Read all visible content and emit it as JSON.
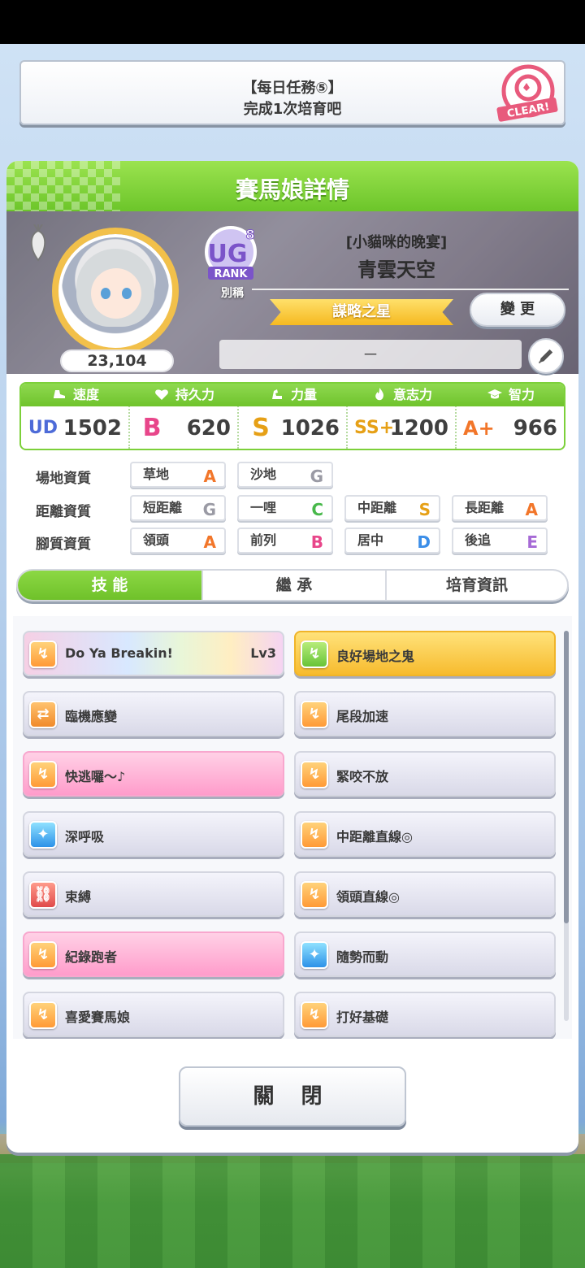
{
  "mission": {
    "title": "【每日任務⑤】",
    "desc": "完成1次培育吧",
    "stamp": "CLEAR!"
  },
  "dialog": {
    "title": "賽馬娘詳情"
  },
  "profile": {
    "points": "23,104",
    "rank_badge": {
      "letters": "UG",
      "sub": "8",
      "label": "RANK"
    },
    "alias_label": "別稱",
    "epithet": "[小貓咪的晚宴]",
    "name": "青雲天空",
    "nickname": "謀略之星",
    "change_label": "變 更",
    "memo": "－"
  },
  "stats": [
    {
      "label": "速度",
      "grade": "UD",
      "value": "1502",
      "icon": "shoe-icon"
    },
    {
      "label": "持久力",
      "grade": "B",
      "value": "620",
      "icon": "heart-icon"
    },
    {
      "label": "力量",
      "grade": "S",
      "value": "1026",
      "icon": "muscle-icon"
    },
    {
      "label": "意志力",
      "grade": "SS+",
      "value": "1200",
      "icon": "flame-icon"
    },
    {
      "label": "智力",
      "grade": "A+",
      "value": "966",
      "icon": "graduation-cap-icon"
    }
  ],
  "aptitudes": {
    "track": {
      "label": "場地資質",
      "items": [
        {
          "name": "草地",
          "grade": "A"
        },
        {
          "name": "沙地",
          "grade": "G"
        }
      ]
    },
    "distance": {
      "label": "距離資質",
      "items": [
        {
          "name": "短距離",
          "grade": "G"
        },
        {
          "name": "一哩",
          "grade": "C"
        },
        {
          "name": "中距離",
          "grade": "S"
        },
        {
          "name": "長距離",
          "grade": "A"
        }
      ]
    },
    "style": {
      "label": "腳質資質",
      "items": [
        {
          "name": "領頭",
          "grade": "A"
        },
        {
          "name": "前列",
          "grade": "B"
        },
        {
          "name": "居中",
          "grade": "D"
        },
        {
          "name": "後追",
          "grade": "E"
        }
      ]
    }
  },
  "tabs": [
    "技 能",
    "繼 承",
    "培育資訊"
  ],
  "skills": [
    {
      "name": "Do Ya Breakin!",
      "level": "Lv3"
    },
    {
      "name": "良好場地之鬼",
      "level": ""
    },
    {
      "name": "臨機應變",
      "level": ""
    },
    {
      "name": "尾段加速",
      "level": ""
    },
    {
      "name": "快逃囉～♪",
      "level": ""
    },
    {
      "name": "緊咬不放",
      "level": ""
    },
    {
      "name": "深呼吸",
      "level": ""
    },
    {
      "name": "中距離直線◎",
      "level": ""
    },
    {
      "name": "束縛",
      "level": ""
    },
    {
      "name": "領頭直線◎",
      "level": ""
    },
    {
      "name": "紀錄跑者",
      "level": ""
    },
    {
      "name": "隨勢而動",
      "level": ""
    },
    {
      "name": "喜愛賽馬娘",
      "level": ""
    },
    {
      "name": "打好基礎",
      "level": ""
    }
  ],
  "close_label": "關 閉",
  "colors": {
    "accent_green": "#6fc32c",
    "gold": "#f5b920",
    "grade_A": "#f2762a",
    "grade_B": "#e8468a",
    "grade_S": "#e6a016",
    "grade_C": "#47b84a",
    "grade_D": "#3b8ee8",
    "grade_E": "#a66ad6",
    "grade_G": "#9a9aa4",
    "grade_UD": "#4d6bd8"
  }
}
